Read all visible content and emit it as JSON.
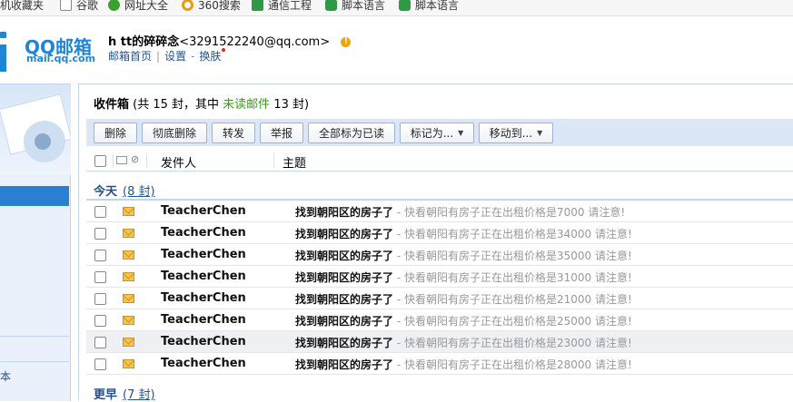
{
  "bookmarks": [
    {
      "label": "手机收藏夹",
      "icon": "phone-icon",
      "color": "#444444"
    },
    {
      "label": "谷歌",
      "icon": "page-icon",
      "color": "#888888"
    },
    {
      "label": "网址大全",
      "icon": "plus-icon",
      "color": "#3aa02c"
    },
    {
      "label": "360搜索",
      "icon": "360-icon",
      "color": "#e69a16"
    },
    {
      "label": "通信工程",
      "icon": "sheet-icon",
      "color": "#2e9a47"
    },
    {
      "label": "脚本语言",
      "icon": "folder-icon",
      "color": "#2e9a47"
    },
    {
      "label": "脚本语言",
      "icon": "folder-icon",
      "color": "#2e9a47"
    }
  ],
  "header": {
    "logo_title": "QQ邮箱",
    "logo_sub": "mail.qq.com",
    "user_name": "h tt的碎碎念",
    "user_email": "<3291522240@qq.com>",
    "links": [
      "邮箱首页",
      "设置",
      "换肤"
    ]
  },
  "left": {
    "bottom_text": "本"
  },
  "inbox": {
    "title": "收件箱",
    "summary_prefix": " (共 15 封，其中 ",
    "unread_label": "未读邮件",
    "summary_suffix": " 13 封)"
  },
  "toolbar": {
    "delete": "删除",
    "delete_forever": "彻底删除",
    "forward": "转发",
    "report": "举报",
    "mark_all_read": "全部标为已读",
    "mark_as": "标记为...",
    "move_to": "移动到..."
  },
  "columns": {
    "sender": "发件人",
    "subject": "主题"
  },
  "groups": {
    "today": {
      "title": "今天",
      "count": "(8 封)"
    },
    "earlier": {
      "title": "更早",
      "count": "(7 封)"
    }
  },
  "emails": [
    {
      "sender": "TeacherChen",
      "subject": "找到朝阳区的房子了",
      "preview": " - 快看朝阳有房子正在出租价格是7000 请注意!"
    },
    {
      "sender": "TeacherChen",
      "subject": "找到朝阳区的房子了",
      "preview": " - 快看朝阳有房子正在出租价格是34000 请注意!"
    },
    {
      "sender": "TeacherChen",
      "subject": "找到朝阳区的房子了",
      "preview": " - 快看朝阳有房子正在出租价格是35000 请注意!"
    },
    {
      "sender": "TeacherChen",
      "subject": "找到朝阳区的房子了",
      "preview": " - 快看朝阳有房子正在出租价格是31000 请注意!"
    },
    {
      "sender": "TeacherChen",
      "subject": "找到朝阳区的房子了",
      "preview": " - 快看朝阳有房子正在出租价格是21000 请注意!"
    },
    {
      "sender": "TeacherChen",
      "subject": "找到朝阳区的房子了",
      "preview": " - 快看朝阳有房子正在出租价格是25000 请注意!"
    },
    {
      "sender": "TeacherChen",
      "subject": "找到朝阳区的房子了",
      "preview": " - 快看朝阳有房子正在出租价格是23000 请注意!"
    },
    {
      "sender": "TeacherChen",
      "subject": "找到朝阳区的房子了",
      "preview": " - 快看朝阳有房子正在出租价格是28000 请注意!"
    }
  ]
}
